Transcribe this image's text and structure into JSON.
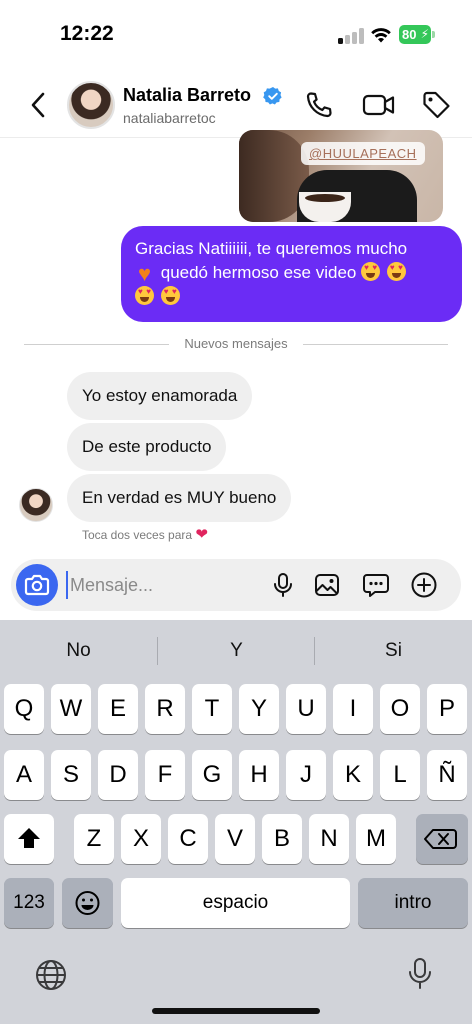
{
  "status": {
    "time": "12:22",
    "battery": "80"
  },
  "header": {
    "name": "Natalia Barreto",
    "handle": "nataliabarretoc"
  },
  "media": {
    "tag": "@HUULAPEACH"
  },
  "messages": {
    "outgoing": {
      "line1": "Gracias Natiiiiii, te queremos mucho",
      "line2": "quedó hermoso ese video"
    },
    "divider": "Nuevos mensajes",
    "incoming": [
      "Yo estoy enamorada",
      "De este producto",
      "En verdad es MUY bueno"
    ],
    "hint": "Toca dos veces para"
  },
  "composer": {
    "placeholder": "Mensaje..."
  },
  "keyboard": {
    "suggestions": [
      "No",
      "Y",
      "Si"
    ],
    "row1": [
      "Q",
      "W",
      "E",
      "R",
      "T",
      "Y",
      "U",
      "I",
      "O",
      "P"
    ],
    "row2": [
      "A",
      "S",
      "D",
      "F",
      "G",
      "H",
      "J",
      "K",
      "L",
      "Ñ"
    ],
    "row3": [
      "Z",
      "X",
      "C",
      "V",
      "B",
      "N",
      "M"
    ],
    "numbers": "123",
    "space": "espacio",
    "return": "intro"
  },
  "colors": {
    "accent": "#6b2cf5",
    "camera": "#3b67f0",
    "verified": "#3897f0"
  }
}
